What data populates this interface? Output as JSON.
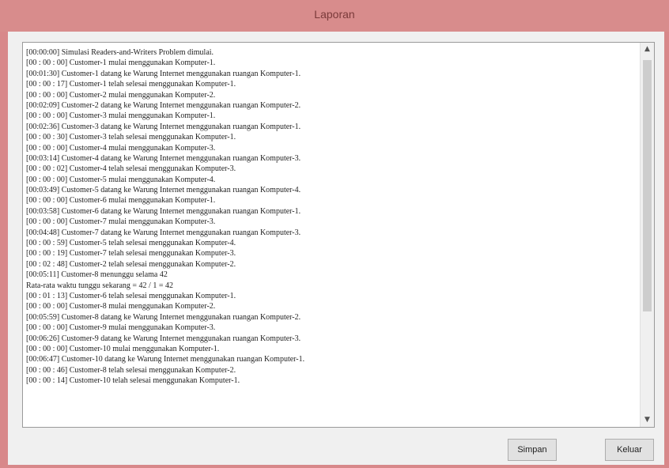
{
  "window": {
    "title": "Laporan"
  },
  "log": {
    "lines": [
      "[00:00:00] Simulasi Readers-and-Writers Problem dimulai.",
      "[00 : 00 : 00] Customer-1 mulai menggunakan  Komputer-1.",
      "[00:01:30] Customer-1 datang ke Warung Internet menggunakan ruangan Komputer-1.",
      "[00 : 00 : 17] Customer-1 telah selesai menggunakan  Komputer-1.",
      "[00 : 00 : 00] Customer-2 mulai menggunakan  Komputer-2.",
      "[00:02:09] Customer-2 datang ke Warung Internet menggunakan ruangan Komputer-2.",
      "[00 : 00 : 00] Customer-3 mulai menggunakan  Komputer-1.",
      "[00:02:36] Customer-3 datang ke Warung Internet menggunakan ruangan Komputer-1.",
      "[00 : 00 : 30] Customer-3 telah selesai menggunakan  Komputer-1.",
      "[00 : 00 : 00] Customer-4 mulai menggunakan  Komputer-3.",
      "[00:03:14] Customer-4 datang ke Warung Internet menggunakan ruangan Komputer-3.",
      "[00 : 00 : 02] Customer-4 telah selesai menggunakan  Komputer-3.",
      "[00 : 00 : 00] Customer-5 mulai menggunakan  Komputer-4.",
      "[00:03:49] Customer-5 datang ke Warung Internet menggunakan ruangan Komputer-4.",
      "[00 : 00 : 00] Customer-6 mulai menggunakan  Komputer-1.",
      "[00:03:58] Customer-6 datang ke Warung Internet menggunakan ruangan Komputer-1.",
      "[00 : 00 : 00] Customer-7 mulai menggunakan  Komputer-3.",
      "[00:04:48] Customer-7 datang ke Warung Internet menggunakan ruangan Komputer-3.",
      "[00 : 00 : 59] Customer-5 telah selesai menggunakan  Komputer-4.",
      "[00 : 00 : 19] Customer-7 telah selesai menggunakan  Komputer-3.",
      "[00 : 02 : 48] Customer-2 telah selesai menggunakan  Komputer-2.",
      "[00:05:11] Customer-8 menunggu selama 42",
      "Rata-rata waktu tunggu sekarang = 42 / 1 = 42",
      "[00 : 01 : 13] Customer-6 telah selesai menggunakan  Komputer-1.",
      "[00 : 00 : 00] Customer-8 mulai menggunakan  Komputer-2.",
      "[00:05:59] Customer-8 datang ke Warung Internet menggunakan ruangan Komputer-2.",
      "[00 : 00 : 00] Customer-9 mulai menggunakan  Komputer-3.",
      "[00:06:26] Customer-9 datang ke Warung Internet menggunakan ruangan Komputer-3.",
      "[00 : 00 : 00] Customer-10 mulai menggunakan  Komputer-1.",
      "[00:06:47] Customer-10 datang ke Warung Internet menggunakan ruangan Komputer-1.",
      "[00 : 00 : 46] Customer-8 telah selesai menggunakan  Komputer-2.",
      "[00 : 00 : 14] Customer-10 telah selesai menggunakan  Komputer-1."
    ]
  },
  "scrollbar": {
    "up_icon": "chevron-up-icon",
    "down_icon": "chevron-down-icon"
  },
  "buttons": {
    "simpan_label": "Simpan",
    "keluar_label": "Keluar"
  },
  "colors": {
    "titlebar": "#d88c8c",
    "title_text": "#7a3a3a"
  }
}
